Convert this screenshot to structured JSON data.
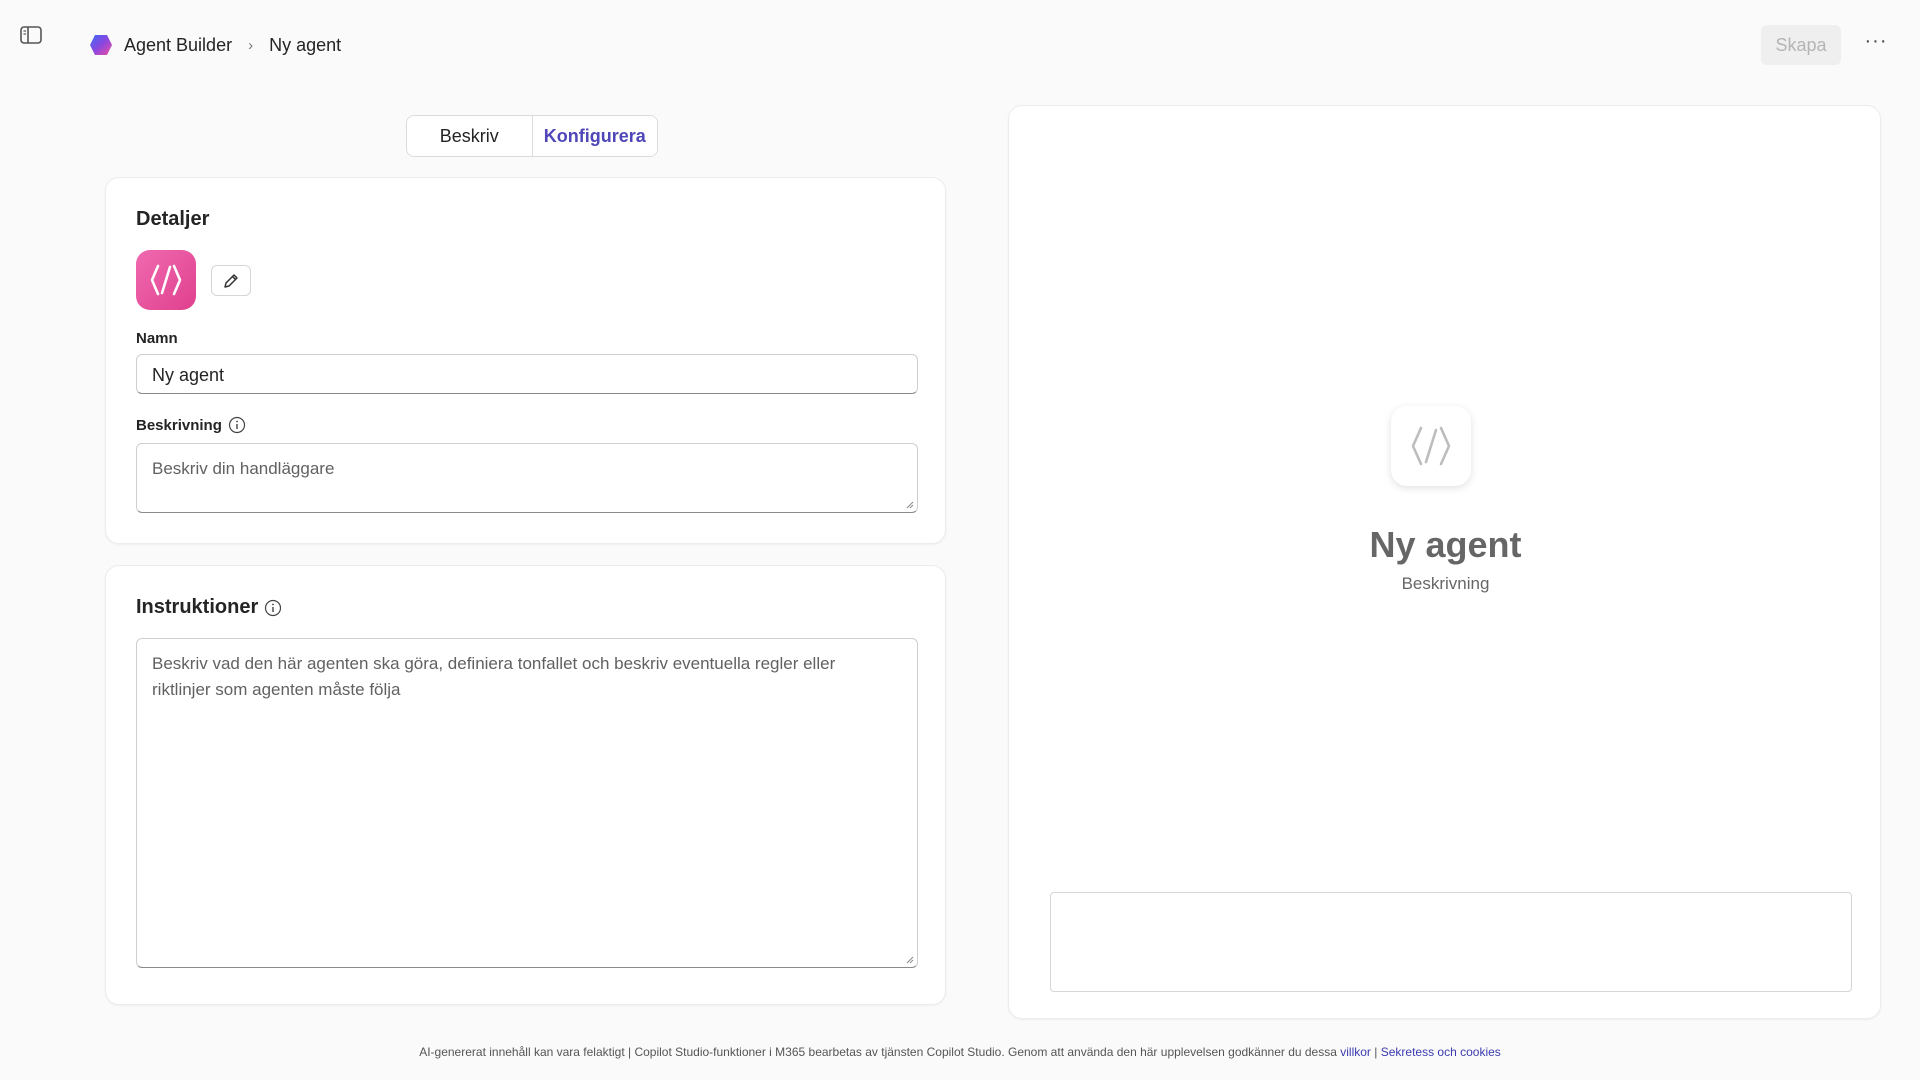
{
  "header": {
    "app_name": "Agent Builder",
    "current_page": "Ny agent",
    "create_label": "Skapa",
    "more_label": "···"
  },
  "tabs": [
    {
      "label": "Beskriv",
      "active": false
    },
    {
      "label": "Konfigurera",
      "active": true
    }
  ],
  "details": {
    "title": "Detaljer",
    "name_label": "Namn",
    "name_value": "Ny agent",
    "description_label": "Beskrivning",
    "description_placeholder": "Beskriv din handläggare"
  },
  "instructions": {
    "title": "Instruktioner",
    "placeholder": "Beskriv vad den här agenten ska göra, definiera tonfallet och beskriv eventuella regler eller riktlinjer som agenten måste följa"
  },
  "preview": {
    "agent_name": "Ny agent",
    "agent_description": "Beskrivning"
  },
  "footer": {
    "text": "AI-genererat innehåll kan vara felaktigt | Copilot Studio-funktioner i M365 bearbetas av tjänsten Copilot Studio. Genom att använda den här upplevelsen godkänner du dessa",
    "terms_link": "villkor",
    "separator": "|",
    "privacy_link": "Sekretess och cookies"
  },
  "colors": {
    "accent": "#4f46b8",
    "agent_icon": "#e0408e"
  }
}
